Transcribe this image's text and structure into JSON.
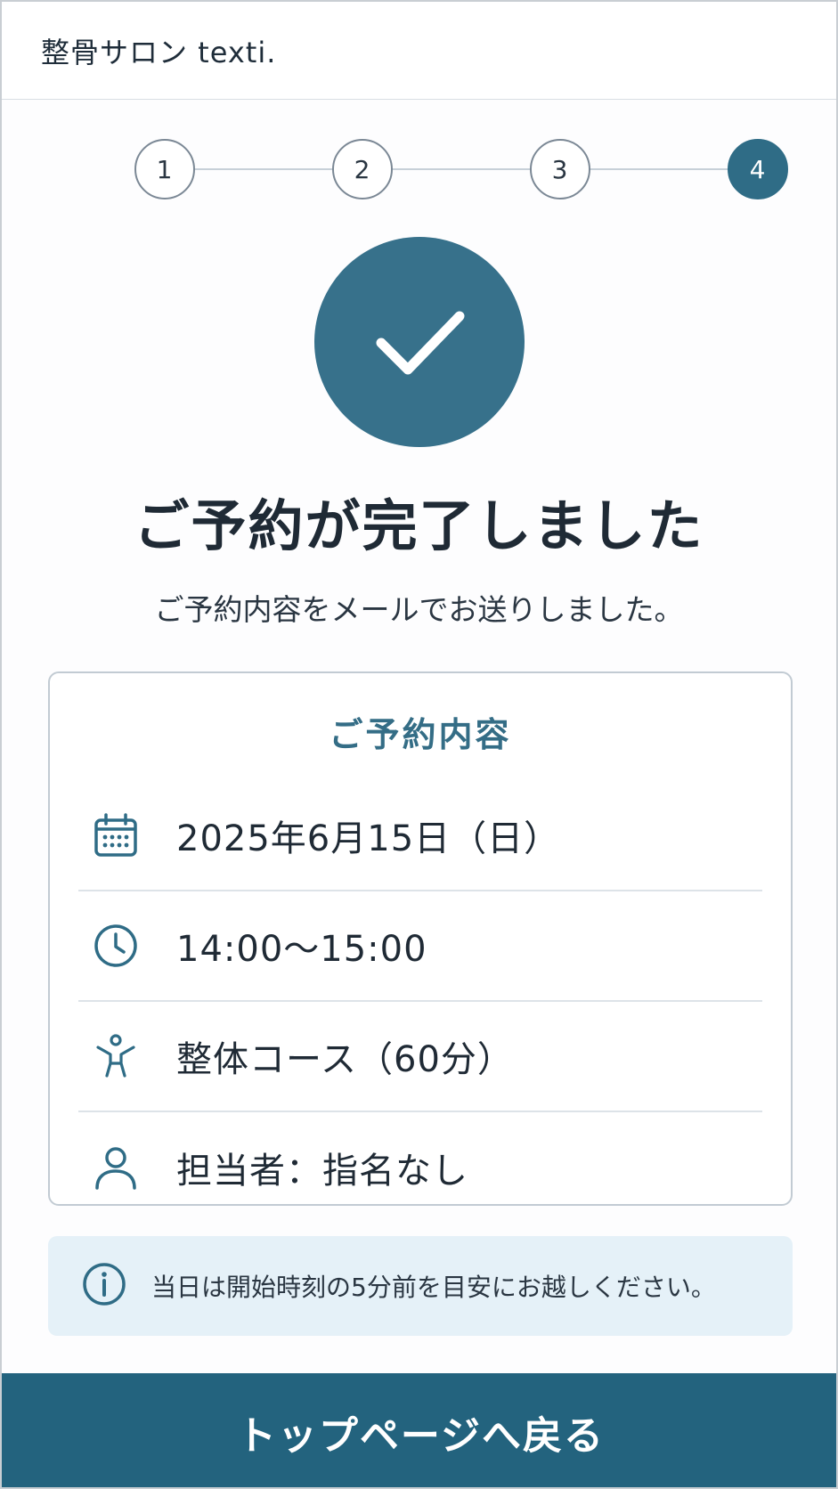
{
  "header": {
    "title": "整骨サロン texti."
  },
  "stepper": {
    "steps": [
      {
        "label": "1",
        "active": false
      },
      {
        "label": "2",
        "active": false
      },
      {
        "label": "3",
        "active": false
      },
      {
        "label": "4",
        "active": true
      }
    ]
  },
  "completion": {
    "title": "ご予約が完了しました",
    "subtitle": "ご予約内容をメールでお送りしました。"
  },
  "details": {
    "title": "ご予約内容",
    "rows": [
      {
        "icon": "calendar-icon",
        "text": "2025年6月15日（日）"
      },
      {
        "icon": "clock-icon",
        "text": "14:00〜15:00"
      },
      {
        "icon": "person-stretch-icon",
        "text": "整体コース（60分）"
      },
      {
        "icon": "user-icon",
        "text": "担当者：指名なし"
      }
    ]
  },
  "notice": {
    "icon": "info-icon",
    "text": "当日は開始時刻の5分前を目安にお越しください。"
  },
  "actions": {
    "back_to_top": "トップページへ戻る"
  },
  "colors": {
    "primary": "#2f6c86",
    "button": "#23637e",
    "notice_bg": "#e5f1f8"
  }
}
